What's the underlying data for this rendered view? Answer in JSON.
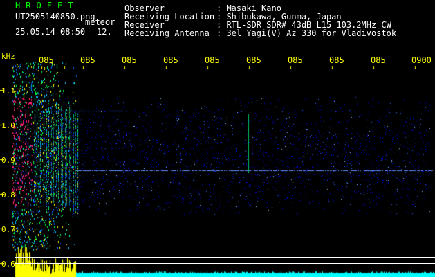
{
  "header": {
    "brand": "HROFFT",
    "filename": "UT2505140850.png",
    "datetime": "25.05.14 08:50",
    "mode": "meteor",
    "count": "12.",
    "rows": [
      {
        "label": "Observer",
        "value": ": Masaki Kano"
      },
      {
        "label": "Receiving Location",
        "value": ": Shibukawa, Gunma, Japan"
      },
      {
        "label": "Receiver",
        "value": ": RTL-SDR SDR# 43dB L15 103.2MHz CW"
      },
      {
        "label": "Receiving Antenna",
        "value": ": 3el Yagi(V) Az 330 for Vladivostok"
      }
    ]
  },
  "axis": {
    "unit": "kHz",
    "y_ticks": [
      "1.1",
      "1.0",
      "0.9",
      "0.8",
      "0.7",
      "0.6"
    ],
    "x_ticks": [
      "085",
      "085",
      "085",
      "085",
      "085",
      "085",
      "085",
      "085",
      "085",
      "0900"
    ]
  },
  "colors": {
    "text": "#ffffff",
    "axis_text": "#ffff00",
    "brand": "#00ff00",
    "noise": "#0000ff",
    "signal": "#ff2060",
    "level_left": "#ffff00",
    "level_right": "#00ffff"
  }
}
